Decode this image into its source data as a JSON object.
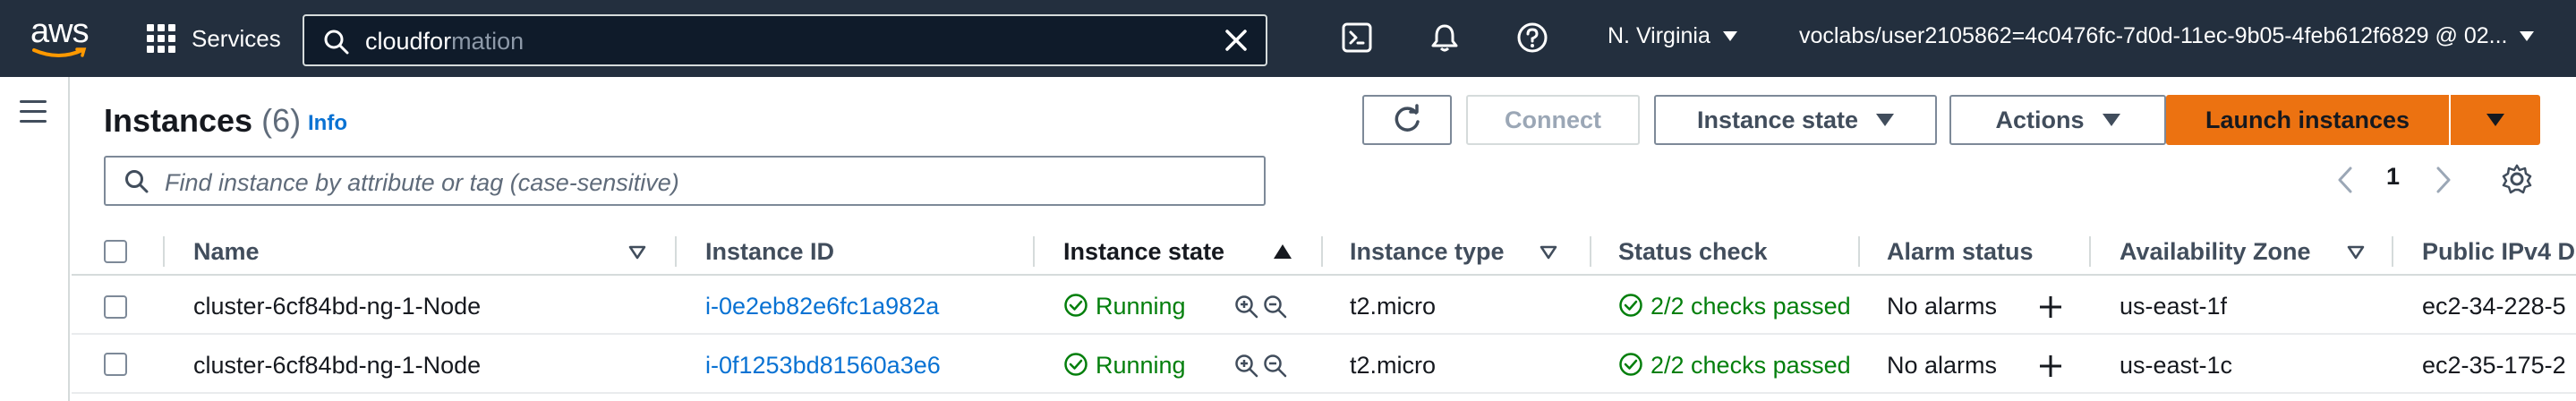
{
  "nav": {
    "logo": "aws",
    "services_label": "Services",
    "search_typed": "cloudfor",
    "search_ghost": "mation",
    "region": "N. Virginia",
    "account": "voclabs/user2105862=4c0476fc-7d0d-11ec-9b05-4feb612f6829 @ 02..."
  },
  "header": {
    "title": "Instances",
    "count": "(6)",
    "info": "Info"
  },
  "toolbar": {
    "connect": "Connect",
    "instance_state": "Instance state",
    "actions": "Actions",
    "launch": "Launch instances"
  },
  "filter": {
    "placeholder": "Find instance by attribute or tag (case-sensitive)"
  },
  "pagination": {
    "page": "1"
  },
  "columns": [
    "Name",
    "Instance ID",
    "Instance state",
    "Instance type",
    "Status check",
    "Alarm status",
    "Availability Zone",
    "Public IPv4 D"
  ],
  "rows": [
    {
      "name": "cluster-6cf84bd-ng-1-Node",
      "instance_id": "i-0e2eb82e6fc1a982a",
      "state": "Running",
      "type": "t2.micro",
      "status_check": "2/2 checks passed",
      "alarm": "No alarms",
      "az": "us-east-1f",
      "public_dns": "ec2-34-228-5"
    },
    {
      "name": "cluster-6cf84bd-ng-1-Node",
      "instance_id": "i-0f1253bd81560a3e6",
      "state": "Running",
      "type": "t2.micro",
      "status_check": "2/2 checks passed",
      "alarm": "No alarms",
      "az": "us-east-1c",
      "public_dns": "ec2-35-175-2"
    }
  ],
  "colors": {
    "nav_bg": "#232f3e",
    "link": "#0972d3",
    "success": "#037f0c",
    "primary": "#ec7211"
  }
}
